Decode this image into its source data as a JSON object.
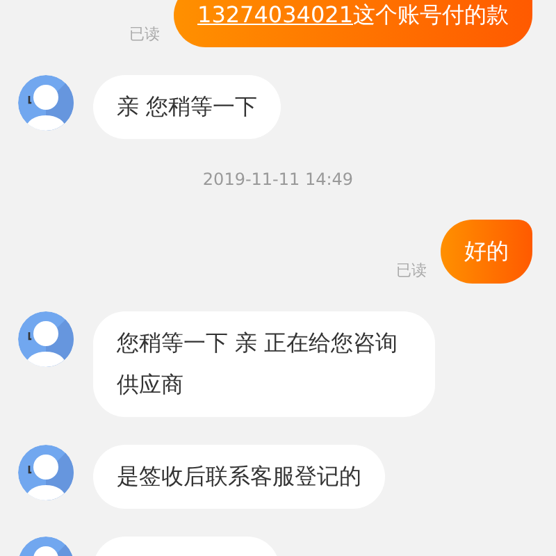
{
  "messages": [
    {
      "kind": "self",
      "text": "13274034021",
      "link": true,
      "rest": "这个账号付的款",
      "read": "已读"
    },
    {
      "kind": "agent",
      "text": "亲 您稍等一下"
    },
    {
      "kind": "time",
      "text": "2019-11-11 14:49"
    },
    {
      "kind": "self",
      "text": "好的",
      "read": "已读"
    },
    {
      "kind": "agent",
      "text": "您稍等一下 亲 正在给您咨询供应商"
    },
    {
      "kind": "agent",
      "text": "是签收后联系客服登记的"
    },
    {
      "kind": "agent"
    }
  ]
}
